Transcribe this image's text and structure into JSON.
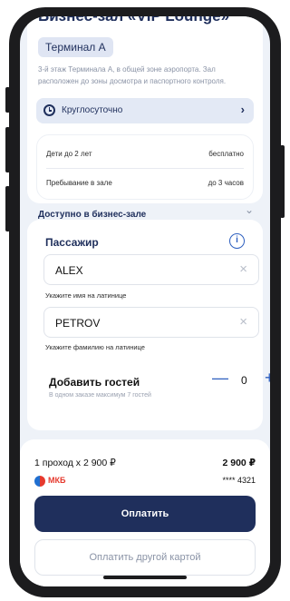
{
  "header": {
    "title_cut": "Бизнес-зал «VIP Lounge»",
    "terminal": "Терминал А",
    "description": "3-й этаж Терминала А, в общей зоне аэропорта. Зал расположен до зоны досмотра и паспортного контроля."
  },
  "hours": {
    "label": "Круглосуточно",
    "icon": "clock-icon"
  },
  "info": [
    {
      "label": "Дети до 2 лет",
      "value": "бесплатно"
    },
    {
      "label": "Пребывание в зале",
      "value": "до 3 часов"
    }
  ],
  "available": {
    "label": "Доступно в бизнес-зале"
  },
  "passenger": {
    "title": "Пассажир",
    "first_name": "ALEX",
    "first_name_hint": "Укажите имя на латинице",
    "last_name": "PETROV",
    "last_name_hint": "Укажите фамилию на латинице"
  },
  "guests": {
    "title": "Добавить гостей",
    "subtitle": "В одном заказе максимум 7 гостей",
    "count": "0"
  },
  "payment": {
    "summary": "1 проход х 2 900 ₽",
    "total": "2 900 ₽",
    "bank": "МКБ",
    "card_mask": "**** 4321",
    "pay_label": "Оплатить",
    "alt_pay_label": "Оплатить другой картой"
  },
  "colors": {
    "primary": "#1f2f5c",
    "accent": "#2d5fbf",
    "background": "#eef2f8",
    "bank_red": "#e63a2e"
  }
}
